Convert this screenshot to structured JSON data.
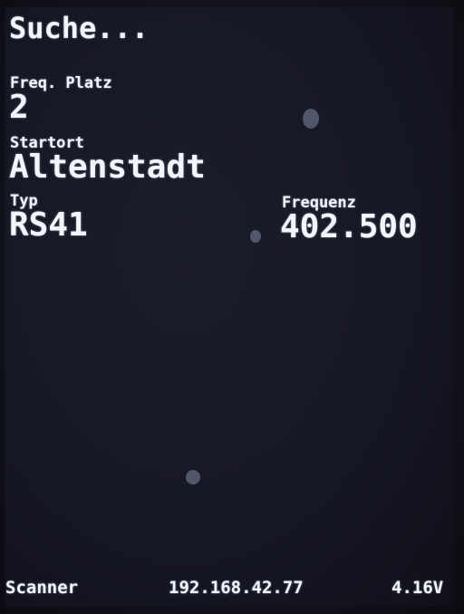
{
  "status": {
    "title": "Suche..."
  },
  "fields": {
    "freq_slot": {
      "label": "Freq. Platz",
      "value": "2"
    },
    "start_site": {
      "label": "Startort",
      "value": "Altenstadt"
    },
    "type": {
      "label": "Typ",
      "value": "RS41"
    },
    "frequency": {
      "label": "Frequenz",
      "value": "402.500"
    }
  },
  "footer": {
    "mode": "Scanner",
    "ip_address": "192.168.42.77",
    "battery_voltage": "4.16V"
  },
  "colors": {
    "background": "#161724",
    "text": "#f3f5fc"
  }
}
